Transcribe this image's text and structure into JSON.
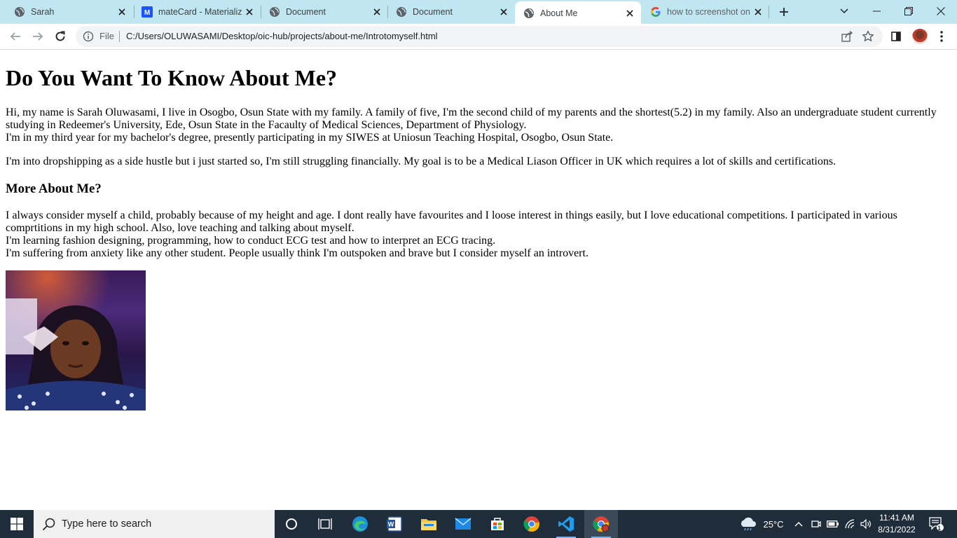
{
  "browser": {
    "tabs": [
      {
        "title": "Sarah",
        "icon": "globe-icon"
      },
      {
        "title": "mateCard - Materializ",
        "icon": "materialize-icon"
      },
      {
        "title": "Document",
        "icon": "globe-icon"
      },
      {
        "title": "Document",
        "icon": "globe-icon"
      },
      {
        "title": "About Me",
        "icon": "globe-icon",
        "active": true
      },
      {
        "title": "how to screenshot on",
        "icon": "google-icon"
      }
    ],
    "address": {
      "scheme_label": "File",
      "url": "C:/Users/OLUWASAMI/Desktop/oic-hub/projects/about-me/Introtomyself.html"
    }
  },
  "page": {
    "heading": "Do You Want To Know About Me?",
    "intro_1": "Hi, my name is Sarah Oluwasami, I live in Osogbo, Osun State with my family. A family of five, I'm the second child of my parents and the shortest(5.2) in my family. Also an undergraduate student currently studying in Redeemer's University, Ede, Osun State in the Facaulty of Medical Sciences, Department of Physiology.",
    "intro_2": "I'm in my third year for my bachelor's degree, presently participating in my SIWES at Uniosun Teaching Hospital, Osogbo, Osun State.",
    "intro_3": "I'm into dropshipping as a side hustle but i just started so, I'm still struggling financially. My goal is to be a Medical Liason Officer in UK which requires a lot of skills and certifications.",
    "subheading": "More About Me?",
    "more_1": "I always consider myself a child, probably because of my height and age. I dont really have favourites and I loose interest in things easily, but I love educational competitions. I participated in various comprtitions in my high school. Also, love teaching and talking about myself.",
    "more_2": "I'm learning fashion designing, programming, how to conduct ECG test and how to interpret an ECG tracing.",
    "more_3": "I'm suffering from anxiety like any other student. People usually think I'm outspoken and brave but I consider myself an introvert."
  },
  "taskbar": {
    "search_placeholder": "Type here to search",
    "temperature": "25°C",
    "time": "11:41 AM",
    "date": "8/31/2022",
    "notification_count": "1"
  },
  "colors": {
    "tabstrip": "#bfe6f1",
    "taskbar": "#1f2d3a"
  }
}
